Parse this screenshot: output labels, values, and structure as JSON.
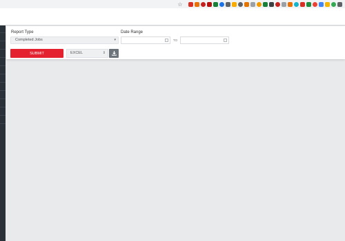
{
  "browser": {
    "extensions": [
      {
        "icon": "star-bookmark-icon",
        "color": "#5f6368"
      },
      {
        "icon": "extension-icon",
        "color": "#d93025"
      },
      {
        "icon": "extension-icon",
        "color": "#e8710a"
      },
      {
        "icon": "extension-icon",
        "color": "#c5221f"
      },
      {
        "icon": "extension-icon",
        "color": "#b31412"
      },
      {
        "icon": "extension-icon",
        "color": "#188038"
      },
      {
        "icon": "extension-icon",
        "color": "#1a73e8"
      },
      {
        "icon": "extension-icon",
        "color": "#5f6368"
      },
      {
        "icon": "extension-icon",
        "color": "#f9ab00"
      },
      {
        "icon": "extension-icon",
        "color": "#5f6368"
      },
      {
        "icon": "extension-icon",
        "color": "#e37400"
      },
      {
        "icon": "extension-icon",
        "color": "#9aa0a6"
      },
      {
        "icon": "extension-icon",
        "color": "#f29900"
      },
      {
        "icon": "extension-icon",
        "color": "#188038"
      },
      {
        "icon": "extension-icon",
        "color": "#3c4043"
      },
      {
        "icon": "extension-icon",
        "color": "#c5221f"
      },
      {
        "icon": "extension-icon",
        "color": "#9aa0a6"
      },
      {
        "icon": "extension-icon",
        "color": "#e8710a"
      },
      {
        "icon": "extension-icon",
        "color": "#12b5cb"
      },
      {
        "icon": "extension-icon",
        "color": "#d93025"
      },
      {
        "icon": "extension-icon",
        "color": "#1e8e3e"
      },
      {
        "icon": "extension-icon",
        "color": "#ea4335"
      },
      {
        "icon": "extension-icon",
        "color": "#4285f4"
      },
      {
        "icon": "extension-icon",
        "color": "#f4b400"
      },
      {
        "icon": "extension-icon",
        "color": "#34a853"
      },
      {
        "icon": "extension-icon",
        "color": "#5f6368"
      }
    ]
  },
  "form": {
    "report_type_label": "Report Type",
    "report_type_value": "Completed Jobs",
    "date_range_label": "Date Range",
    "date_from_value": "",
    "date_to_separator": "TO",
    "date_to_value": "",
    "submit_label": "SUBMIT",
    "format_value": "EXCEL"
  },
  "colors": {
    "submit": "#e4222f",
    "download": "#6c737b",
    "sidebar": "#2b3139",
    "background": "#e9eaec"
  }
}
